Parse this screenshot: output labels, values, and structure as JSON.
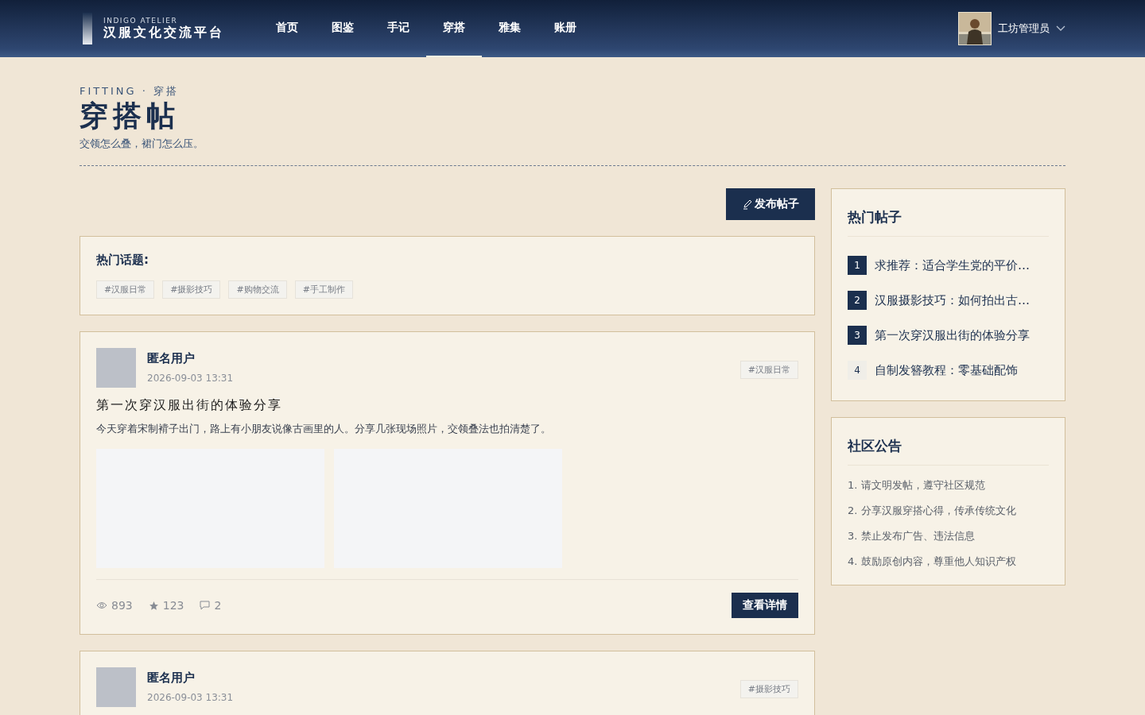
{
  "brand": {
    "subtitle": "INDIGO ATELIER",
    "title": "汉服文化交流平台"
  },
  "nav": [
    {
      "label": "首页",
      "selected": false
    },
    {
      "label": "图鉴",
      "selected": false
    },
    {
      "label": "手记",
      "selected": false
    },
    {
      "label": "穿搭",
      "selected": true
    },
    {
      "label": "雅集",
      "selected": false
    },
    {
      "label": "账册",
      "selected": false
    }
  ],
  "user": {
    "name": "工坊管理员"
  },
  "page": {
    "eyebrow": "FITTING · 穿搭",
    "title": "穿搭帖",
    "subtitle": "交领怎么叠，裙门怎么压。"
  },
  "publish_button": "发布帖子",
  "topics": {
    "title": "热门话题:",
    "tags": [
      "#汉服日常",
      "#摄影技巧",
      "#购物交流",
      "#手工制作"
    ]
  },
  "posts": [
    {
      "author": "匿名用户",
      "time": "2026-09-03 13:31",
      "tag": "#汉服日常",
      "title": "第一次穿汉服出街的体验分享",
      "body": "今天穿着宋制褙子出门，路上有小朋友说像古画里的人。分享几张现场照片，交领叠法也拍清楚了。",
      "images": [
        {
          "kind": "placeholder"
        },
        {
          "kind": "placeholder"
        }
      ],
      "views": "893",
      "stars": "123",
      "comments": "2",
      "detail_button": "查看详情"
    },
    {
      "author": "匿名用户",
      "time": "2026-09-03 13:31",
      "tag": "#摄影技巧"
    }
  ],
  "hot_posts": {
    "title": "热门帖子",
    "items": [
      {
        "rank": "1",
        "title": "求推荐：适合学生党的平价…",
        "top": true
      },
      {
        "rank": "2",
        "title": "汉服摄影技巧：如何拍出古…",
        "top": true
      },
      {
        "rank": "3",
        "title": "第一次穿汉服出街的体验分享",
        "top": true
      },
      {
        "rank": "4",
        "title": "自制发簪教程：零基础配饰",
        "top": false
      }
    ]
  },
  "notice": {
    "title": "社区公告",
    "items": [
      "1. 请文明发帖，遵守社区规范",
      "2. 分享汉服穿搭心得，传承传统文化",
      "3. 禁止发布广告、违法信息",
      "4. 鼓励原创内容，尊重他人知识产权"
    ]
  }
}
